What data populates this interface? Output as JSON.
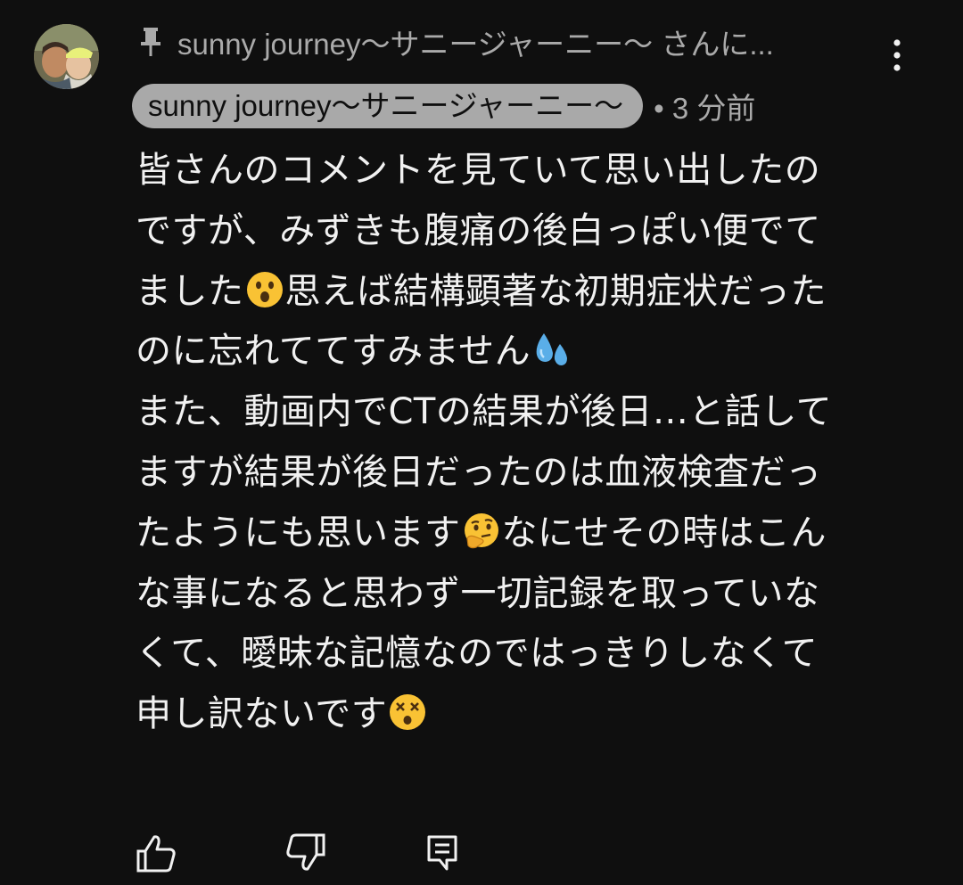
{
  "pinned": {
    "text": "sunny journey〜サニージャーニー〜 さんに..."
  },
  "author": {
    "name": "sunny journey〜サニージャーニー〜",
    "time": "• 3 分前"
  },
  "comment": {
    "lines": [
      "皆さんのコメントを見ていて思い出したの",
      "ですが、みずきも腹痛の後白っぽい便でて",
      "ました",
      "思えば結構顕著な初期症状だった",
      "のに忘れててすみません",
      "また、動画内でCTの結果が後日…と話して",
      "ますが結果が後日だったのは血液検査だっ",
      "たようにも思います",
      "なにせその時はこん",
      "な事になると思わず一切記録を取っていな",
      "くて、曖昧な記憶なのではっきりしなくて",
      "申し訳ないです"
    ],
    "emojis": [
      "surprised-face",
      "sweat-droplets",
      "thinking-face",
      "dizzy-face"
    ]
  },
  "actions": [
    "like",
    "dislike",
    "reply"
  ],
  "colors": {
    "background": "#0f0f0f",
    "text": "#f1f1f1",
    "secondary": "#aaaaaa",
    "chip": "#a9a9a9"
  }
}
